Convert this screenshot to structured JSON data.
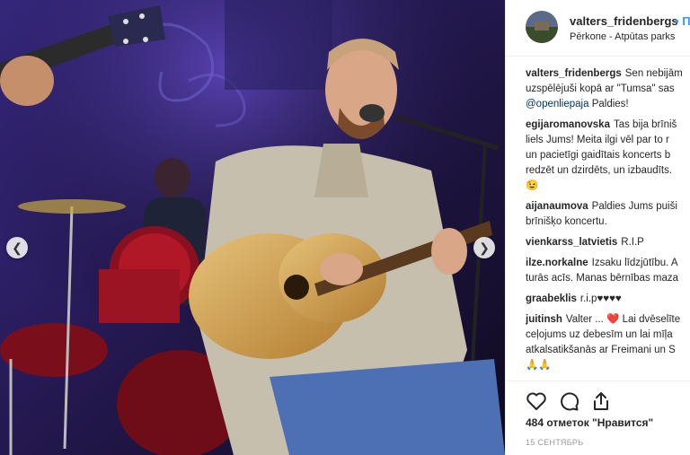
{
  "photo": {
    "alt": "",
    "prev_icon": "chevron-left-icon",
    "next_icon": "chevron-right-icon"
  },
  "header": {
    "username": "valters_fridenbergs",
    "separator": "•",
    "follow_label": "П",
    "location": "Pērkone - Atpūtas parks"
  },
  "comments": [
    {
      "user": "valters_fridenbergs",
      "lines": [
        "Sen nebijām",
        "uzspēlējuši kopā ar \"Tumsa\" sas",
        ""
      ],
      "mention": "@openliepaja",
      "mention_tail": " Paldies!"
    },
    {
      "user": "egijaromanovska",
      "lines": [
        "Tas bija brīniš",
        "liels Jums! Meita ilgi vēl par to r",
        "un pacietīgi gaidītais koncerts b",
        "redzēt un dzirdēts, un izbaudīts."
      ],
      "emoji": "😉"
    },
    {
      "user": "aijanaumova",
      "lines": [
        "Paldies Jums puiši",
        "brīnišķo koncertu."
      ]
    },
    {
      "user": "vienkarss_latvietis",
      "lines": [
        "R.I.P"
      ]
    },
    {
      "user": "ilze.norkalne",
      "lines": [
        "Izsaku līdzjūtību. A",
        "turās acīs. Manas bērnības maza"
      ]
    },
    {
      "user": "graabeklis",
      "lines": [
        "r.i.p♥♥♥♥"
      ]
    },
    {
      "user": "juitinsh",
      "lines": [
        "Valter ... ❤️  Lai dvēselīte",
        "ceļojums uz debesīm un lai mīļa",
        "atkalsatikšanās ar Freimani un S",
        "🙏🙏"
      ]
    }
  ],
  "actions": {
    "like_icon": "heart-icon",
    "comment_icon": "comment-icon",
    "share_icon": "share-icon"
  },
  "likes_text": "484 отметок \"Нравится\"",
  "date_text": "15 СЕНТЯБРЬ",
  "colors": {
    "link": "#003569",
    "follow": "#3897f0",
    "text": "#262626",
    "muted": "#999999"
  }
}
